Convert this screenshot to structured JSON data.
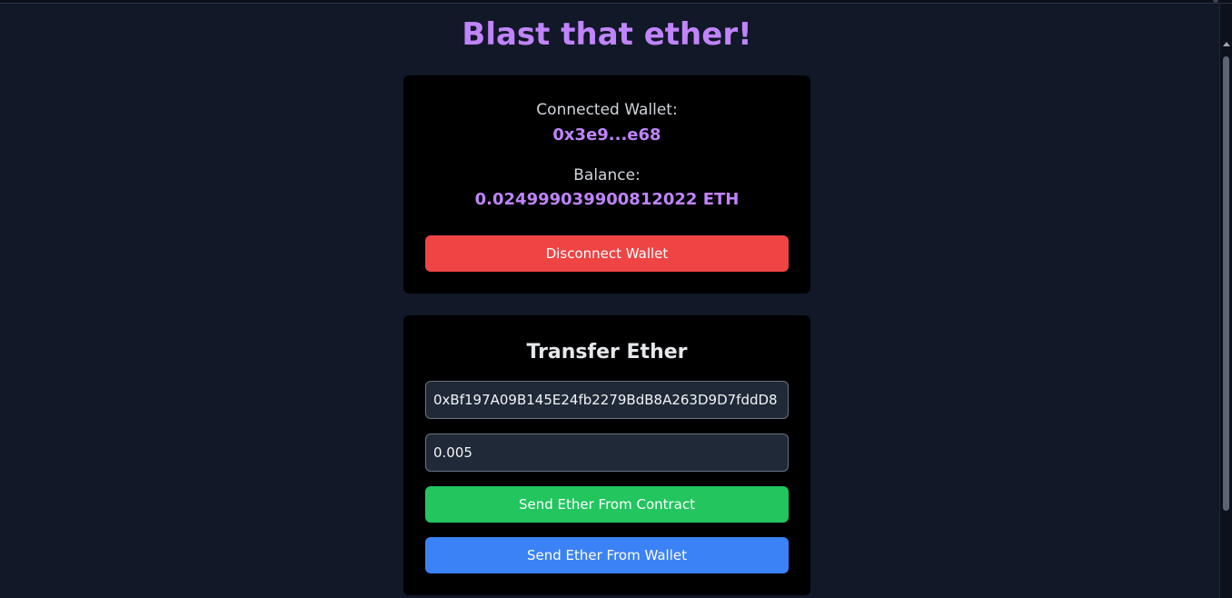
{
  "header": {
    "title": "Blast that ether!"
  },
  "wallet_card": {
    "connected_label": "Connected Wallet:",
    "address": "0x3e9...e68",
    "balance_label": "Balance:",
    "balance": "0.024999039900812022 ETH",
    "disconnect_label": "Disconnect Wallet"
  },
  "transfer_card": {
    "heading": "Transfer Ether",
    "recipient_value": "0xBf197A09B145E24fb2279BdB8A263D9D7fddD8",
    "amount_value": "0.005",
    "send_contract_label": "Send Ether From Contract",
    "send_wallet_label": "Send Ether From Wallet"
  },
  "colors": {
    "background": "#111827",
    "accent": "#c084fc",
    "card": "#000000",
    "danger": "#ef4444",
    "success": "#22c55e",
    "primary": "#3b82f6"
  }
}
